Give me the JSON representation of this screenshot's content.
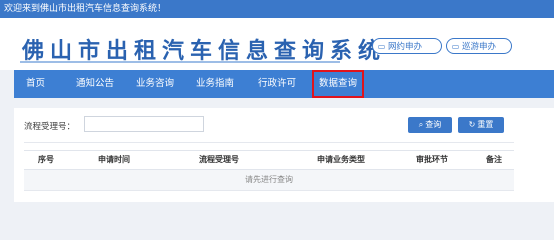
{
  "top_bar": {
    "welcome_text": "欢迎来到佛山市出租汽车信息查询系统！"
  },
  "header": {
    "title": "佛山市出租汽车信息查询系统",
    "buttons": [
      {
        "label": "网约申办",
        "icon": "monitor-icon"
      },
      {
        "label": "巡游申办",
        "icon": "monitor-icon"
      }
    ]
  },
  "nav": {
    "items": [
      {
        "label": "首页"
      },
      {
        "label": "通知公告"
      },
      {
        "label": "业务咨询"
      },
      {
        "label": "业务指南"
      },
      {
        "label": "行政许可"
      },
      {
        "label": "数据查询",
        "active": true
      }
    ],
    "active_highlight_color": "#e0141c"
  },
  "search": {
    "label": "流程受理号：",
    "input_value": "",
    "query_button": "查询",
    "reset_button": "重置"
  },
  "table": {
    "columns": [
      "序号",
      "申请时间",
      "流程受理号",
      "申请业务类型",
      "审批环节",
      "备注"
    ],
    "empty_text": "请先进行查询"
  },
  "colors": {
    "brand": "#3b78c9",
    "nav": "#3d7fd3"
  }
}
